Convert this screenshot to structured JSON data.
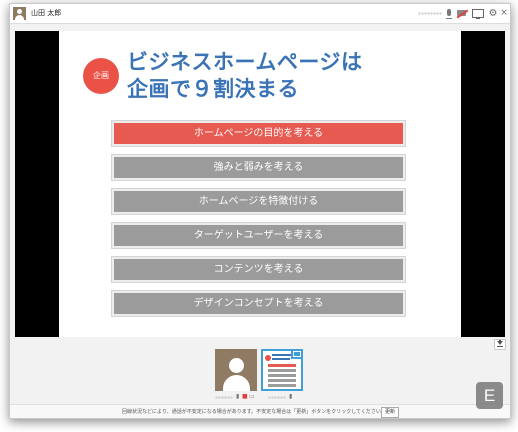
{
  "titlebar": {
    "user_name": "山田 太郎",
    "icons": [
      "avatar-icon",
      "microphone-icon",
      "camera-off-icon",
      "screen-share-icon",
      "gear-icon",
      "close-icon"
    ],
    "close_glyph": "×",
    "gear_glyph": "⚙"
  },
  "slide": {
    "badge": "企画",
    "title_line1": "ビジネスホームページは",
    "title_line2": "企画で９割決まる",
    "steps": [
      "ホームページの目的を考える",
      "強みと弱みを考える",
      "ホームページを特徴付ける",
      "ターゲットユーザーを考える",
      "コンテンツを考える",
      "デザインコンセプトを考える"
    ],
    "active_step": 0
  },
  "colors": {
    "accent_red": "#e75a51",
    "title_blue": "#3a73b6",
    "step_gray": "#9b9b9b",
    "screen_share_blue": "#3fa0d6",
    "avatar_brown": "#8f7a64"
  },
  "status": {
    "message": "回線状況などにより、通話が不安定になる場合があります。不安定な場合は「更新」ボタンをクリックしてください。",
    "update_button": "更新"
  },
  "corner_badge": "E"
}
